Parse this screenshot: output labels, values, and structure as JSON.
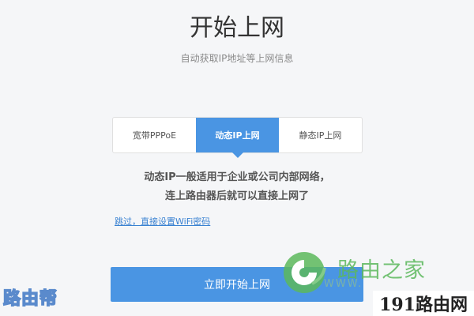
{
  "page": {
    "title": "开始上网",
    "subtitle": "自动获取IP地址等上网信息"
  },
  "tabs": [
    {
      "label": "宽带PPPoE",
      "active": false
    },
    {
      "label": "动态IP上网",
      "active": true
    },
    {
      "label": "静态IP上网",
      "active": false
    }
  ],
  "description": {
    "line1": "动态IP一般适用于企业或公司内部网络，",
    "line2": "连上路由器后就可以直接上网了"
  },
  "skip_link": "跳过，直接设置WiFi密码",
  "start_button": "立即开始上网",
  "watermarks": {
    "left": "路由帮",
    "brand": "路由之家",
    "brand_url": "WWW.",
    "right": "191路由网"
  },
  "colors": {
    "accent": "#4a95e3",
    "link": "#3a82d2",
    "brand_green": "#5cb85c"
  },
  "icons": {
    "brand_logo": "luyouzhijia-logo-icon"
  }
}
